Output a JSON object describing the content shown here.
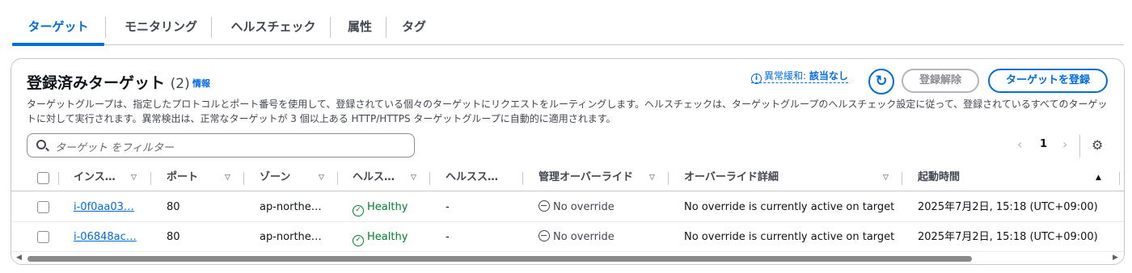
{
  "tabs": [
    {
      "label": "ターゲット"
    },
    {
      "label": "モニタリング"
    },
    {
      "label": "ヘルスチェック"
    },
    {
      "label": "属性"
    },
    {
      "label": "タグ"
    }
  ],
  "panel": {
    "title": "登録済みターゲット",
    "count": "(2)",
    "info_label": "情報",
    "anomaly_prefix": "異常緩和: ",
    "anomaly_value": "該当なし",
    "deregister_label": "登録解除",
    "register_label": "ターゲットを登録",
    "description": "ターゲットグループは、指定したプロトコルとポート番号を使用して、登録されている個々のターゲットにリクエストをルーティングします。ヘルスチェックは、ターゲットグループのヘルスチェック設定に従って、登録されているすべてのターゲットに対して実行されます。異常検出は、正常なターゲットが 3 個以上ある HTTP/HTTPS ターゲットグループに自動的に適用されます。",
    "search_placeholder": "ターゲット をフィルター",
    "page": "1"
  },
  "table": {
    "columns": [
      "インス…",
      "ポート",
      "ゾーン",
      "ヘルス…",
      "ヘルスス…",
      "管理オーバーライド",
      "オーバーライド詳細",
      "起動時間"
    ],
    "rows": [
      {
        "instance": "i-0f0aa03…",
        "port": "80",
        "zone": "ap-northe…",
        "health": "Healthy",
        "health_status": "-",
        "override": "No override",
        "override_detail": "No override is currently active on target",
        "launch_time": "2025年7月2日, 15:18 (UTC+09:00)"
      },
      {
        "instance": "i-06848ac…",
        "port": "80",
        "zone": "ap-northe…",
        "health": "Healthy",
        "health_status": "-",
        "override": "No override",
        "override_detail": "No override is currently active on target",
        "launch_time": "2025年7月2日, 15:18 (UTC+09:00)"
      }
    ]
  },
  "colors": {
    "accent": "#006ce0",
    "healthy": "#00802f"
  }
}
